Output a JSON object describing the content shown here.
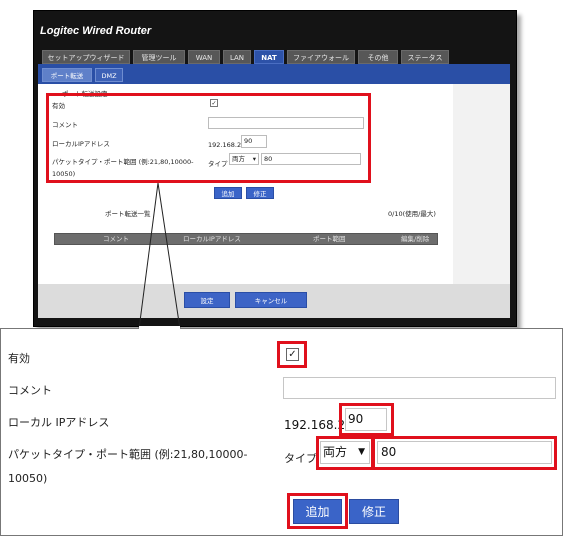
{
  "router": {
    "title": "Logitec  Wired  Router",
    "tabs": [
      {
        "label": "セットアップウィザード"
      },
      {
        "label": "管理ツール"
      },
      {
        "label": "WAN"
      },
      {
        "label": "LAN"
      },
      {
        "label": "NAT"
      },
      {
        "label": "ファイアウォール"
      },
      {
        "label": "その他"
      },
      {
        "label": "ステータス"
      }
    ],
    "active_tab": "NAT",
    "subtabs": [
      {
        "label": "ポート転送"
      },
      {
        "label": "DMZ"
      }
    ],
    "section_title": "ポート転送設定",
    "form": {
      "enable_label": "有効",
      "enable_checked": "✓",
      "comment_label": "コメント",
      "comment_value": "",
      "local_ip_label": "ローカルIPアドレス",
      "ip_prefix": "192.168.2.",
      "ip_last_octet": "90",
      "port_label_line1": "パケットタイプ・ポート範囲 (例:21,80,10000-",
      "port_label_line2": "10050)",
      "type_label": "タイプ",
      "type_value": "両方",
      "port_value": "80"
    },
    "buttons": {
      "add": "追加",
      "modify": "修正"
    },
    "list": {
      "title": "ポート転送一覧",
      "count": "0/10(使用/最大)",
      "columns": [
        "コメント",
        "ローカルIPアドレス",
        "ポート範囲",
        "編集/削除"
      ]
    },
    "footer": {
      "save": "設定",
      "cancel": "キャンセル"
    }
  },
  "zoom": {
    "enable_label": "有効",
    "enable_checked": "✓",
    "comment_label": "コメント",
    "comment_value": "",
    "local_ip_label": "ローカル IPアドレス",
    "ip_prefix": "192.168.2.",
    "ip_last_octet": "90",
    "port_label_line1": "パケットタイプ・ポート範囲 (例:21,80,10000-",
    "port_label_line2": "10050)",
    "type_label": "タイプ",
    "type_value": "両方",
    "port_value": "80",
    "add": "追加",
    "modify": "修正"
  },
  "colors": {
    "highlight": "#e0101c",
    "tab_active": "#2d52a8",
    "button": "#3a64c8"
  }
}
